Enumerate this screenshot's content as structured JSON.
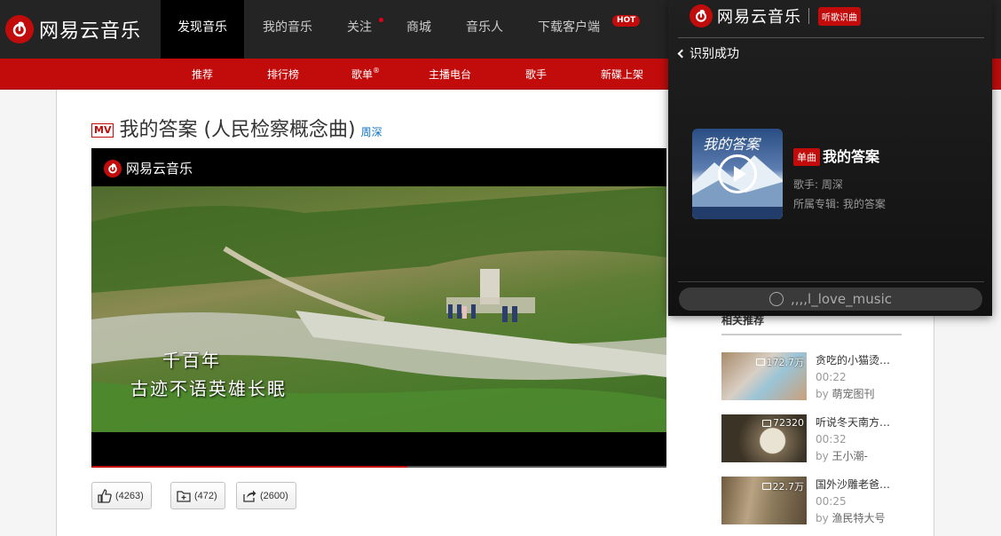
{
  "app": {
    "brand": "网易云音乐"
  },
  "nav": {
    "items": [
      {
        "label": "发现音乐"
      },
      {
        "label": "我的音乐"
      },
      {
        "label": "关注"
      },
      {
        "label": "商城"
      },
      {
        "label": "音乐人"
      },
      {
        "label": "下载客户端",
        "badge": "HOT"
      }
    ]
  },
  "subnav": {
    "items": [
      {
        "label": "推荐"
      },
      {
        "label": "排行榜"
      },
      {
        "label": "歌单",
        "sup": "®"
      },
      {
        "label": "主播电台"
      },
      {
        "label": "歌手"
      },
      {
        "label": "新碟上架"
      }
    ]
  },
  "mv": {
    "tag": "MV",
    "title": "我的答案 (人民检察概念曲)",
    "artist": "周深",
    "player_brand": "网易云音乐",
    "subtitle_line1": "千百年",
    "subtitle_line2": "古迹不语英雄长眠",
    "progress_fraction": 0.55
  },
  "actions": {
    "like_count": "(4263)",
    "collect_count": "(472)",
    "share_count": "(2600)"
  },
  "related": {
    "heading": "相关推荐",
    "items": [
      {
        "count": "172.7万",
        "title": "贪吃的小猫烫…",
        "duration": "00:22",
        "by_prefix": "by",
        "author": "萌宠图刊"
      },
      {
        "count": "72320",
        "title": "听说冬天南方…",
        "duration": "00:32",
        "by_prefix": "by",
        "author": "王小潮-"
      },
      {
        "count": "22.7万",
        "title": "国外沙雕老爸…",
        "duration": "00:25",
        "by_prefix": "by",
        "author": "渔民特大号"
      }
    ]
  },
  "popup": {
    "brand": "网易云音乐",
    "feature_tag": "听歌识曲",
    "back_label": "识别成功",
    "cover_text": "我的答案",
    "single_tag": "单曲",
    "song_name": "我的答案",
    "singer_line": "歌手: 周深",
    "album_line": "所属专辑: 我的答案",
    "user": ",,,,l_love_music"
  },
  "colors": {
    "brand_red": "#c20c0c",
    "nav_bg": "#242424",
    "link_blue": "#0c73c2"
  }
}
